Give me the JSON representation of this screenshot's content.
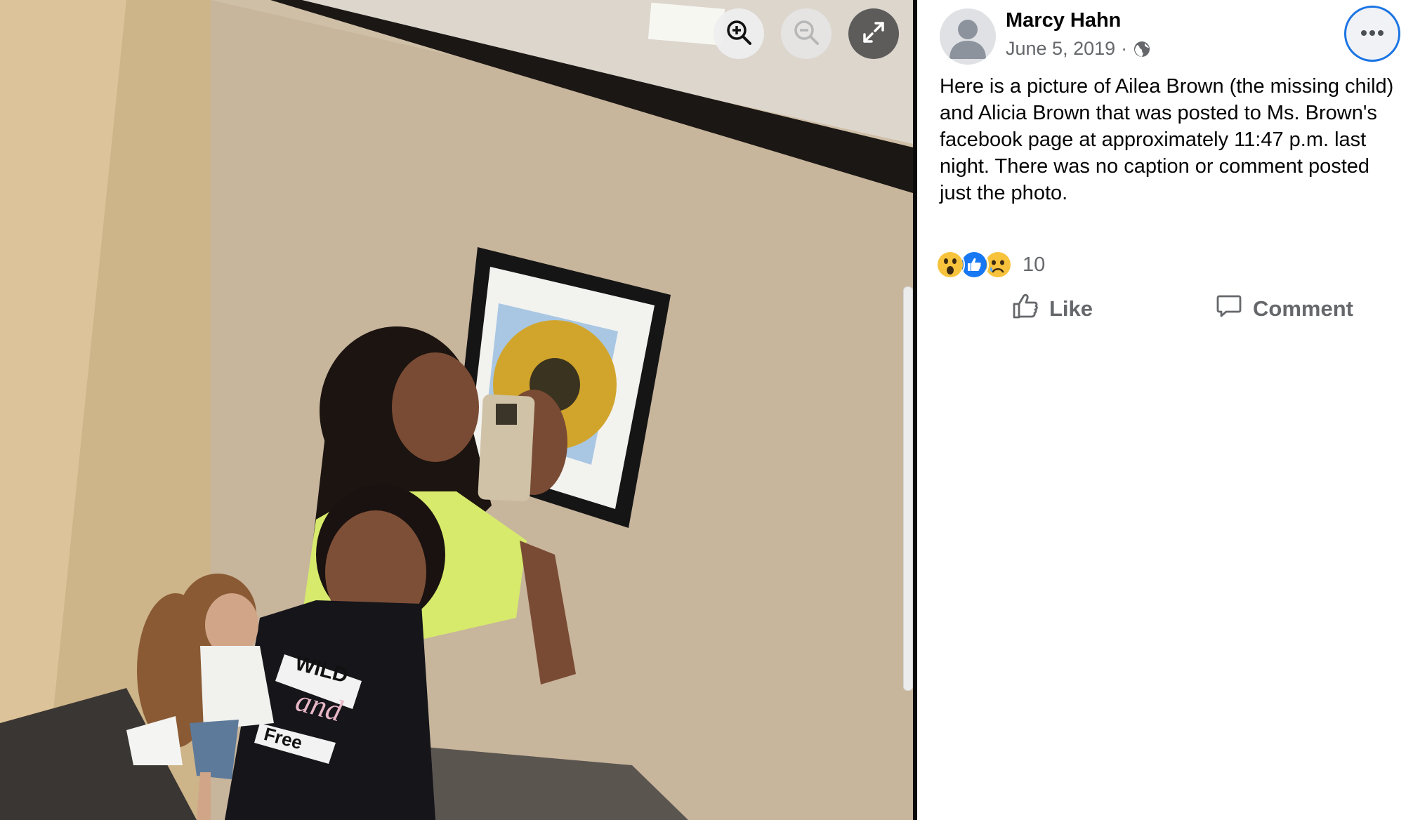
{
  "viewer": {
    "toolbar": [
      {
        "name": "zoom-in",
        "icon": "zoom-in-icon",
        "state": "enabled"
      },
      {
        "name": "zoom-out",
        "icon": "zoom-out-icon",
        "state": "disabled"
      },
      {
        "name": "fullscreen",
        "icon": "expand-icon",
        "state": "enabled"
      }
    ],
    "photo": {
      "subject": "mirror selfie of a woman holding a phone and a girl holding a doll",
      "shirt_text": [
        "WILD",
        "and",
        "Free"
      ]
    }
  },
  "post": {
    "author": "Marcy Hahn",
    "date": "June 5, 2019",
    "separator": "·",
    "audience_icon": "globe-icon",
    "more_icon": "more-options-icon",
    "text": "Here is a picture of Ailea Brown (the missing child) and Alicia Brown that was posted to Ms. Brown's facebook page at approximately 11:47 p.m. last night. There was no caption or comment posted just the photo.",
    "reactions": {
      "icons": [
        "wow-icon",
        "like-reaction-icon",
        "sad-icon"
      ],
      "count": "10"
    },
    "actions": {
      "like": "Like",
      "comment": "Comment"
    }
  },
  "colors": {
    "accent": "#1b74e4",
    "text_primary": "#050505",
    "text_secondary": "#65676b"
  }
}
